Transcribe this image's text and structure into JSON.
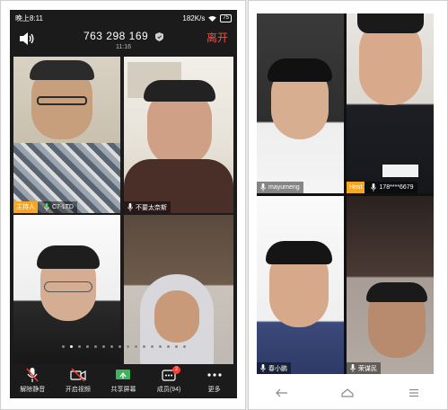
{
  "left_phone": {
    "status": {
      "time": "晚上8:11",
      "network": "182K/s",
      "battery": "75"
    },
    "meeting": {
      "id": "763 298 169",
      "duration": "11:16",
      "leave_label": "离开"
    },
    "tiles": [
      {
        "name": "C7-LTD",
        "host_badge": "主持人"
      },
      {
        "name": "不要太奈斯"
      },
      {
        "name": ""
      },
      {
        "name": ""
      }
    ],
    "toolbar": [
      {
        "label": "解除静音",
        "icon": "mic-muted-icon"
      },
      {
        "label": "开启视频",
        "icon": "video-off-icon"
      },
      {
        "label": "共享屏幕",
        "icon": "share-screen-icon"
      },
      {
        "label": "成员(94)",
        "icon": "members-icon",
        "badge": "2"
      },
      {
        "label": "更多",
        "icon": "more-icon"
      }
    ]
  },
  "right_phone": {
    "tiles": [
      {
        "name": "mayumeng"
      },
      {
        "name": "178****6679",
        "host_badge": "Host"
      },
      {
        "name": "春小鹏"
      },
      {
        "name": "荣谋民"
      }
    ]
  },
  "colors": {
    "leave": "#ff4a3a",
    "host_badge": "#f5a623",
    "badge": "#ff3b30"
  }
}
